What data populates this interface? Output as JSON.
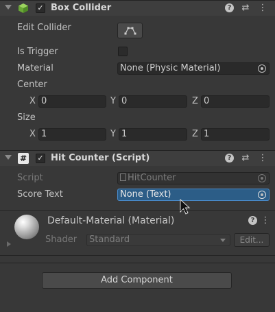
{
  "box_collider": {
    "title": "Box Collider",
    "edit_collider_label": "Edit Collider",
    "is_trigger_label": "Is Trigger",
    "material_label": "Material",
    "material_value": "None (Physic Material)",
    "center_label": "Center",
    "center": {
      "x_label": "X",
      "x": "0",
      "y_label": "Y",
      "y": "0",
      "z_label": "Z",
      "z": "0"
    },
    "size_label": "Size",
    "size": {
      "x_label": "X",
      "x": "1",
      "y_label": "Y",
      "y": "1",
      "z_label": "Z",
      "z": "1"
    }
  },
  "hit_counter": {
    "title": "Hit Counter (Script)",
    "script_label": "Script",
    "script_value": "HitCounter",
    "score_text_label": "Score Text",
    "score_text_value": "None (Text)"
  },
  "material": {
    "title": "Default-Material (Material)",
    "shader_label": "Shader",
    "shader_value": "Standard",
    "edit_label": "Edit..."
  },
  "add_component_label": "Add Component",
  "icons": {
    "help": "?",
    "settings": "⇄",
    "more": "⋮",
    "check": "✓",
    "hash": "#"
  },
  "colors": {
    "background": "#383838",
    "highlight_field": "#2c5d87",
    "collider_icon": "#7bc142"
  }
}
